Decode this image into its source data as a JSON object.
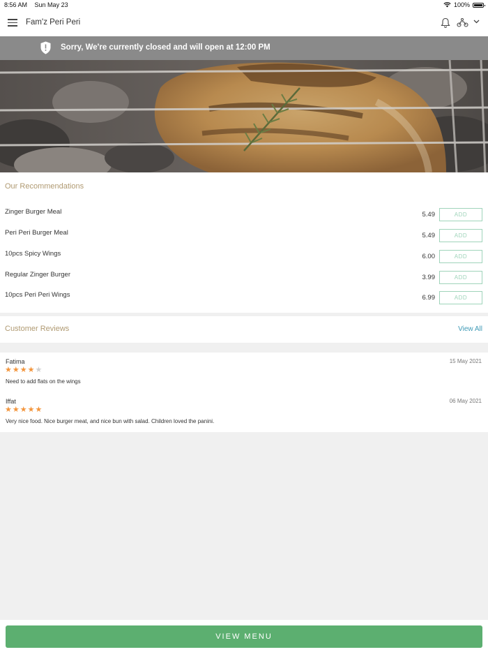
{
  "status_bar": {
    "time": "8:56 AM",
    "date": "Sun May 23",
    "battery": "100%"
  },
  "header": {
    "title": "Fam'z Peri Peri"
  },
  "banner": {
    "message": "Sorry, We're currently closed and will open at 12:00 PM"
  },
  "recommendations": {
    "title": "Our Recommendations",
    "add_label": "ADD",
    "items": [
      {
        "name": "Zinger Burger Meal",
        "price": "5.49"
      },
      {
        "name": "Peri Peri Burger Meal",
        "price": "5.49"
      },
      {
        "name": "10pcs Spicy Wings",
        "price": "6.00"
      },
      {
        "name": "Regular Zinger Burger",
        "price": "3.99"
      },
      {
        "name": "10pcs Peri Peri Wings",
        "price": "6.99"
      }
    ]
  },
  "reviews": {
    "title": "Customer Reviews",
    "view_all": "View All",
    "items": [
      {
        "name": "Fatima",
        "date": "15 May 2021",
        "rating": 4,
        "text": "Need to add flats on the wings"
      },
      {
        "name": "Iffat",
        "date": "06 May 2021",
        "rating": 5,
        "text": "Very nice food. Nice burger meat, and nice bun with salad. Children loved the panini."
      }
    ]
  },
  "footer": {
    "view_menu_label": "VIEW MENU"
  },
  "colors": {
    "accent": "#5caf70",
    "section_title": "#b09a72",
    "link": "#3f9ab6",
    "star": "#f3953c",
    "banner": "#8a8a8a"
  }
}
